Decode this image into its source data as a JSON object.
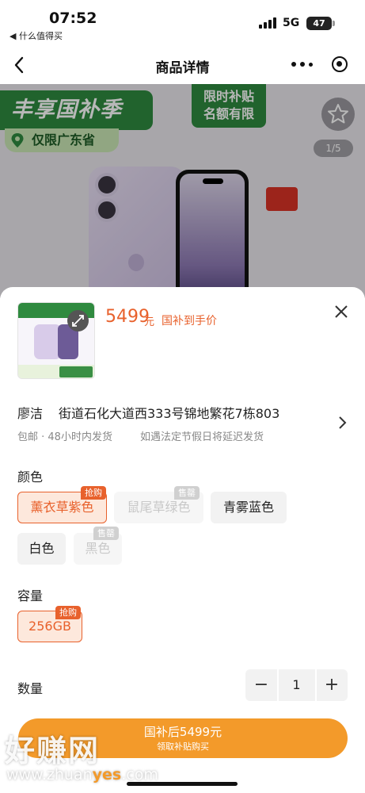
{
  "status": {
    "time": "07:52",
    "back_app": "◀ 什么值得买",
    "network": "5G",
    "battery": "47"
  },
  "nav": {
    "title": "商品详情"
  },
  "hero": {
    "promo_banner": "丰享国补季",
    "region_tag": "仅限广东省",
    "limited_banner_line1": "限时补贴",
    "limited_banner_line2": "名额有限",
    "photo_counter": "1/5"
  },
  "sheet": {
    "price": "5499",
    "price_unit": "元",
    "price_label": "国补到手价",
    "address": {
      "name": "廖洁",
      "line": "街道石化大道西333号锦地繁花7栋803"
    },
    "shipping": "包邮 · 48小时内发货",
    "shipping_note": "如遇法定节假日将延迟发货",
    "color": {
      "title": "颜色",
      "options": [
        {
          "label": "薰衣草紫色",
          "badge": "抢购",
          "state": "selected"
        },
        {
          "label": "鼠尾草绿色",
          "badge": "售罄",
          "state": "disabled"
        },
        {
          "label": "青雾蓝色",
          "badge": "",
          "state": "normal"
        },
        {
          "label": "白色",
          "badge": "",
          "state": "normal"
        },
        {
          "label": "黑色",
          "badge": "售罄",
          "state": "disabled"
        }
      ]
    },
    "capacity": {
      "title": "容量",
      "options": [
        {
          "label": "256GB",
          "badge": "抢购",
          "state": "selected"
        }
      ]
    },
    "quantity": {
      "title": "数量",
      "minus": "−",
      "value": "1",
      "plus": "+"
    },
    "buy_button": {
      "main": "国补后5499元",
      "sub": "领取补贴购买"
    }
  },
  "watermark": {
    "text": "好赚网",
    "url_prefix": "www.zhuan",
    "url_highlight": "yes",
    "url_suffix": ".com"
  },
  "colors": {
    "accent": "#e8612c",
    "buy": "#f39a2a",
    "promo_green": "#2f8a3f"
  }
}
